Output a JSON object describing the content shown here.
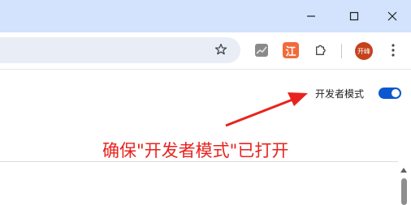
{
  "window": {
    "minimize_icon": "minimize-icon",
    "maximize_icon": "maximize-icon",
    "close_icon": "close-icon"
  },
  "toolbar": {
    "bookmark_icon": "star-icon",
    "extensions": [
      {
        "name": "chart-extension-icon"
      },
      {
        "name": "jiang-extension",
        "label": "江",
        "color": "#f26a3a"
      },
      {
        "name": "extensions-puzzle-icon"
      }
    ],
    "profile": {
      "label": "开峰",
      "color": "#c5421b"
    },
    "menu_icon": "more-vert-icon"
  },
  "page": {
    "developer_mode_label": "开发者模式",
    "developer_mode_enabled": true,
    "toggle_color": "#0b57d0"
  },
  "annotation": {
    "text": "确保\"开发者模式\"已打开",
    "color": "#e8231e"
  }
}
